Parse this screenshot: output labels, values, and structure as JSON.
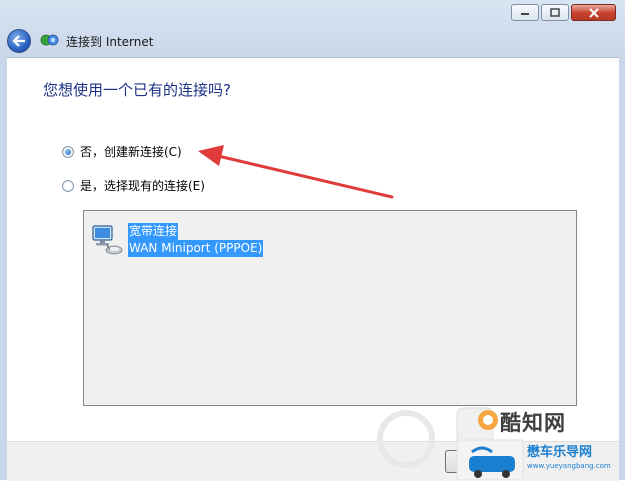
{
  "window": {
    "title": "连接到 Internet",
    "controls": [
      "minimize",
      "maximize",
      "close"
    ]
  },
  "page": {
    "question": "您想使用一个已有的连接吗?"
  },
  "options": [
    {
      "label": "否，创建新连接(C)",
      "checked": true
    },
    {
      "label": "是，选择现有的连接(E)",
      "checked": false
    }
  ],
  "connections": [
    {
      "name": "宽带连接",
      "device": "WAN Miniport (PPPOE)",
      "selected": true,
      "icon": "network-computer-icon"
    }
  ],
  "watermark": {
    "brand": "酷知网",
    "site_name": "懋车乐导网",
    "url": "www.yueyangbang.com"
  },
  "colors": {
    "heading": "#1e3287",
    "selection": "#3399ff",
    "annotation_arrow": "#e03a3a",
    "close_button": "#c8402c"
  }
}
